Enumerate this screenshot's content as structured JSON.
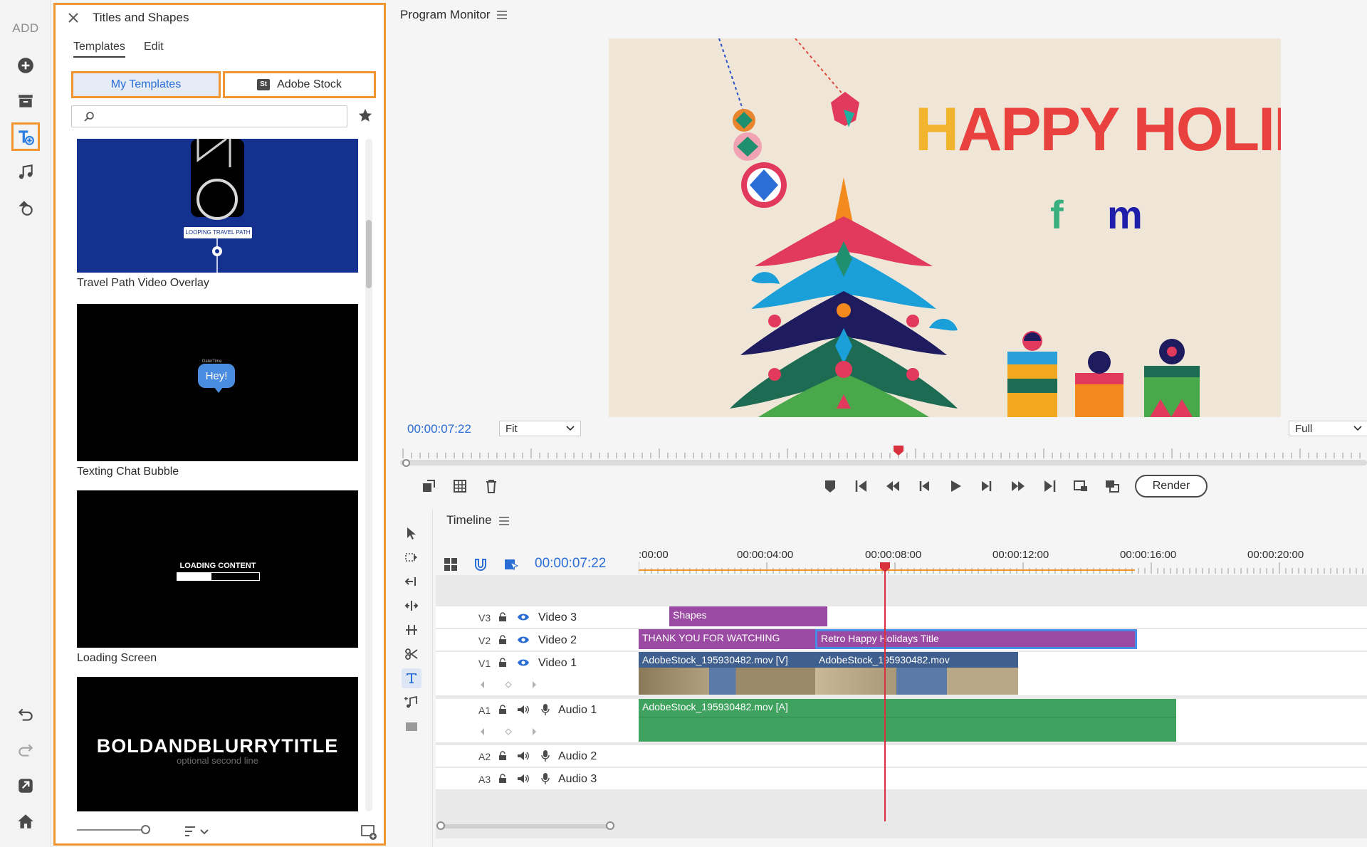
{
  "toolbar": {
    "add_label": "ADD",
    "items": [
      "add-icon",
      "media-icon",
      "titles-icon",
      "music-icon",
      "shapes-icon"
    ],
    "bottom_items": [
      "undo-icon",
      "redo-icon",
      "share-icon",
      "home-icon"
    ]
  },
  "panel": {
    "title": "Titles and Shapes",
    "tabs": [
      "Templates",
      "Edit"
    ],
    "active_tab": "Templates",
    "segments": {
      "my": "My Templates",
      "stock": "Adobe Stock",
      "stock_badge": "St"
    },
    "search": {
      "placeholder": "",
      "value": ""
    },
    "templates": [
      {
        "name": "Travel Path Video Overlay",
        "thumb_text": "LOOPING TRAVEL PATH"
      },
      {
        "name": "Texting Chat Bubble",
        "thumb_text": "Hey!",
        "thumb_sub": "Date/Time"
      },
      {
        "name": "Loading Screen",
        "thumb_text": "LOADING CONTENT"
      },
      {
        "name": "",
        "thumb_text": "BOLDANDBLURRYTITLE",
        "thumb_sub": "optional second line"
      }
    ]
  },
  "program_monitor": {
    "title": "Program Monitor",
    "timecode": "00:00:07:22",
    "fit": "Fit",
    "quality": "Full",
    "render": "Render",
    "frame": {
      "headline_first": "H",
      "headline_rest": "APPY HOLIDAYS",
      "letters": [
        "f",
        "m"
      ]
    }
  },
  "timeline": {
    "title": "Timeline",
    "timecode": "00:00:07:22",
    "ruler": [
      ":00:00",
      "00:00:04:00",
      "00:00:08:00",
      "00:00:12:00",
      "00:00:16:00",
      "00:00:20:00"
    ],
    "tracks": [
      {
        "id": "V3",
        "name": "Video 3"
      },
      {
        "id": "V2",
        "name": "Video 2"
      },
      {
        "id": "V1",
        "name": "Video 1"
      },
      {
        "id": "A1",
        "name": "Audio 1"
      },
      {
        "id": "A2",
        "name": "Audio 2"
      },
      {
        "id": "A3",
        "name": "Audio 3"
      }
    ],
    "clips": {
      "shapes": "Shapes",
      "thank_you": "THANK YOU FOR WATCHING",
      "retro": "Retro Happy Holidays Title",
      "v1a": "AdobeStock_195930482.mov [V]",
      "v1b": "AdobeStock_195930482.mov",
      "a1": "AdobeStock_195930482.mov [A]"
    }
  },
  "colors": {
    "accent": "#2b6dd6",
    "highlight": "#f0952f",
    "playhead": "#d8303c",
    "title_clip": "#9a4aa2",
    "audio_clip": "#3fa35f"
  }
}
